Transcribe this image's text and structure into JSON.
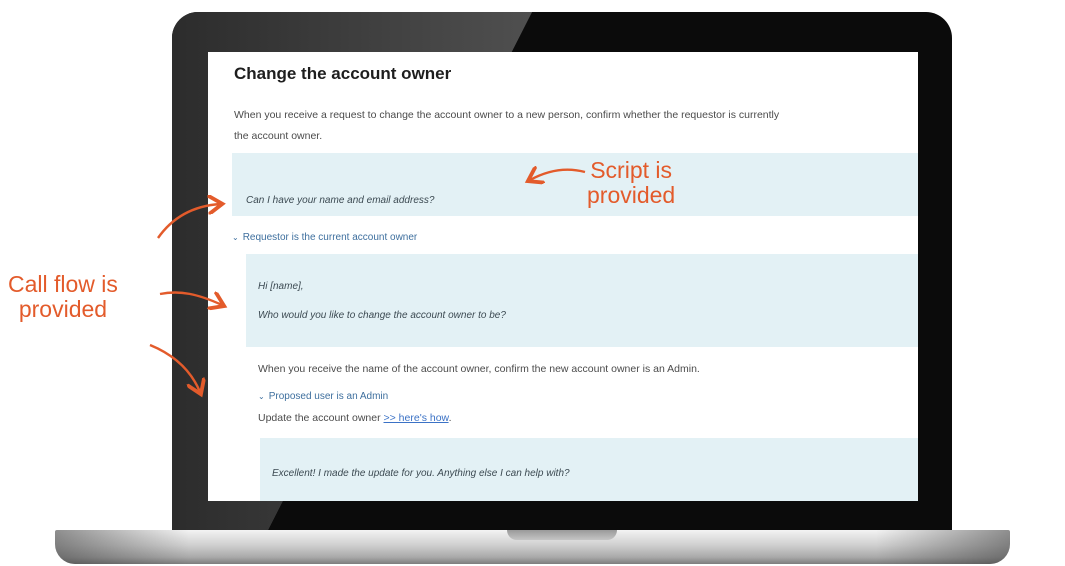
{
  "page": {
    "title": "Change the account owner",
    "intro": "When you receive a request to change the account owner to a new person, confirm whether the requestor is currently the account owner.",
    "script1": "Can I have your name and email address?",
    "toggle1": "Requestor is the current account owner",
    "script2_line1": "Hi [name],",
    "script2_line2": "Who would you like to change the account owner to be?",
    "confirm_text": "When you receive the name of the account owner, confirm the new account owner is an Admin.",
    "toggle2": "Proposed user is an Admin",
    "update_text": "Update the account owner ",
    "update_link": ">> here's how",
    "update_suffix": ".",
    "script3": "Excellent! I made the update for you. Anything else I can help with?"
  },
  "annotations": {
    "script_line1": "Script is",
    "script_line2": "provided",
    "callflow_line1": "Call flow is",
    "callflow_line2": "provided",
    "color": "#e35b2b"
  },
  "icons": {
    "chevron": "chevron-down-icon",
    "arrow": "curved-arrow-icon"
  }
}
